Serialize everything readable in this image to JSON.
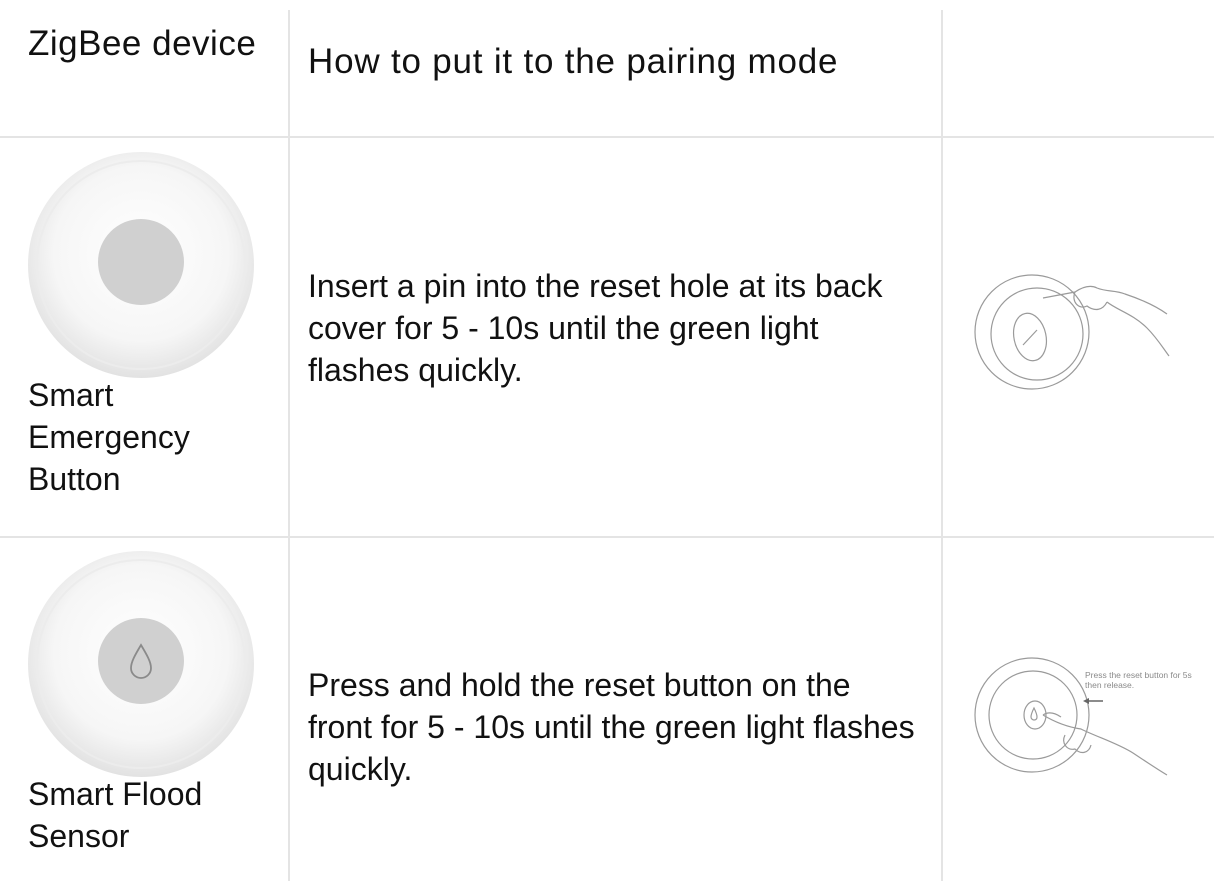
{
  "table": {
    "headers": {
      "device": "ZigBee device",
      "how": "How to put it to the pairing mode"
    },
    "rows": [
      {
        "device_name": "Smart Emergency Button",
        "instruction": "Insert a pin into the reset hole at its back cover for 5 - 10s until the green light flashes quickly.",
        "device_image": "emergency-button-photo",
        "pair_image": "pin-reset-illustration"
      },
      {
        "device_name": "Smart Flood Sensor",
        "instruction": "Press and hold the reset button on the front for 5 - 10s until the green light flashes quickly.",
        "device_image": "flood-sensor-photo",
        "pair_image": "press-reset-illustration",
        "pair_caption": "Press the reset button for 5s then release."
      }
    ]
  }
}
